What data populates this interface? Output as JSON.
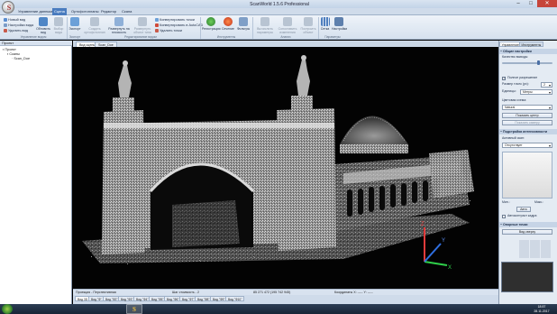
{
  "window": {
    "title": "ScanWorld 1.5.6 Professional",
    "app_logo_letter": "S",
    "minimize": "–",
    "maximize": "□",
    "close": "✕"
  },
  "menu": {
    "tabs": [
      "Управление данными",
      "Сцена",
      "Ортофотопланы",
      "Редактор",
      "Скана"
    ],
    "active_index": 1
  },
  "ribbon": {
    "left_small": [
      "Новый вид",
      "Настройки вида",
      "Удалить вид"
    ],
    "update_view": "Обновить вид",
    "hide": "Выбор вида",
    "export": "Экспорт",
    "create_ortho": "Создать ортофотоплан",
    "unfold": "Развернуть на плоскость",
    "unfold_tube": "Развернуть объект типа",
    "convert_small": [
      "Конвертировать точки",
      "Конвертировать в AutoCAD",
      "Удалить точки"
    ],
    "registration": "Регистрация",
    "linking": "Сечение",
    "filters": "Фильтры",
    "calc_params": "Вычислить параметры",
    "create_objects": "Сопоставить изменения",
    "create_profile": "Построить объект",
    "grid": "Сетка",
    "settings": "Настройки",
    "group_labels": [
      "Управление видом",
      "Экспорт",
      "Редактирование видом",
      "Инструменты",
      "Анализ",
      "Параметры"
    ]
  },
  "project_panel": {
    "header": "Проект",
    "tree": [
      "Проект",
      "Сканы",
      "Scan_Doe"
    ]
  },
  "view_tabs": [
    "Вид сцены",
    "Scan_Doe"
  ],
  "status": {
    "projection": "Проекция - Перспективная",
    "step": "Шаг стоимость - 2",
    "coords": "85 271 472 (195 742 945)",
    "coordinates_label": "Координаты X: ----- Y: -----"
  },
  "bottom_tabs": [
    "Вид 3D",
    "Вид \"Ф\"",
    "Вид \"Ф2\"",
    "Вид \"Ф3\"",
    "Вид \"Ф4\"",
    "Вид \"Ф5\"",
    "Вид \"Ф6\"",
    "Вид \"Ф7\"",
    "Вид \"Ф8\"",
    "Вид \"Ф9\"",
    "Вид \"Ф10\""
  ],
  "right_panel": {
    "tabs": [
      "Управление",
      "Инструменты"
    ],
    "sections": {
      "general": "Общие настройки",
      "intensity": "Подстройка интенсивности",
      "tools": "Опорные точки"
    },
    "quality_label": "Качество выводы",
    "full_resolution": "Полное разрешение",
    "point_size_label": "Размер точек (px):",
    "point_size_value": "2",
    "units_label": "Единицы:",
    "units_value": "Метры",
    "color_scheme_label": "Цветовая схема:",
    "color_scheme_value": "Natural",
    "show_center": "Показать центр",
    "show_grid": "Показать камеру",
    "active_scan_label": "Активный скан:",
    "active_scan_value": "Отсутствует",
    "min_label": "Мин.:",
    "max_label": "Макс.:",
    "reset": "Авто",
    "auto_contrast": "Автоконтраст кадра",
    "view_from_top": "Вид сверху"
  },
  "axes": {
    "x": "X",
    "y": "Y",
    "z": "Z"
  },
  "taskbar": {
    "clock_time": "18:57",
    "clock_date": "28.11.2017",
    "task_letter": "S"
  }
}
